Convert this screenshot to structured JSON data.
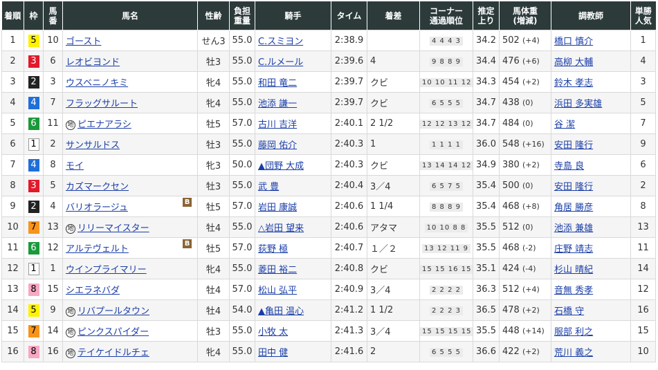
{
  "headers": {
    "rank": "着順",
    "waku": "枠",
    "umaban": [
      "馬",
      "番"
    ],
    "horse": "馬名",
    "age": "性齢",
    "weight": [
      "負担",
      "重量"
    ],
    "jockey": "騎手",
    "time": "タイム",
    "margin": "着差",
    "corner": [
      "コーナー",
      "通過順位"
    ],
    "last": [
      "推定",
      "上り"
    ],
    "bodyweight": [
      "馬体重",
      "(増減)"
    ],
    "trainer": "調教師",
    "pop": [
      "単勝",
      "人気"
    ]
  },
  "chi_mark": "地",
  "blinker_mark": "B",
  "colors": {
    "header_bg": "#2c3a3a",
    "link": "#1a3ea8",
    "waku": {
      "1": "#ffffff",
      "2": "#222222",
      "3": "#e21a2a",
      "4": "#1e6fd9",
      "5": "#fef200",
      "6": "#1a9a3a",
      "7": "#f7941d",
      "8": "#f6a8c4"
    }
  },
  "rows": [
    {
      "rank": "1",
      "waku": "5",
      "umaban": "10",
      "horse": "ゴースト",
      "chi": false,
      "blinker": false,
      "age": "せん3",
      "weight": "55.0",
      "jockey": "C.スミヨン",
      "time": "2:38.9",
      "margin": "",
      "corner": "4 4 4 3",
      "last": "34.2",
      "bw": "502",
      "bwd": "(+4)",
      "trainer": "橋口 慎介",
      "pop": "1"
    },
    {
      "rank": "2",
      "waku": "3",
      "umaban": "6",
      "horse": "レオビヨンド",
      "chi": false,
      "blinker": false,
      "age": "牡3",
      "weight": "55.0",
      "jockey": "C.ルメール",
      "time": "2:39.6",
      "margin": "4",
      "corner": "9 8 8 9",
      "last": "34.4",
      "bw": "476",
      "bwd": "(+6)",
      "trainer": "高柳 大輔",
      "pop": "4"
    },
    {
      "rank": "3",
      "waku": "2",
      "umaban": "3",
      "horse": "ウスベニノキミ",
      "chi": false,
      "blinker": false,
      "age": "牝4",
      "weight": "55.0",
      "jockey": "和田 竜二",
      "time": "2:39.7",
      "margin": "クビ",
      "corner": "10 10 11 12",
      "last": "34.3",
      "bw": "454",
      "bwd": "(+2)",
      "trainer": "鈴木 孝志",
      "pop": "3"
    },
    {
      "rank": "4",
      "waku": "4",
      "umaban": "7",
      "horse": "フラッグサルート",
      "chi": false,
      "blinker": false,
      "age": "牝4",
      "weight": "55.0",
      "jockey": "池添 謙一",
      "time": "2:39.7",
      "margin": "クビ",
      "corner": "6 5 5 5",
      "last": "34.7",
      "bw": "438",
      "bwd": "(0)",
      "trainer": "浜田 多実雄",
      "pop": "5"
    },
    {
      "rank": "5",
      "waku": "6",
      "umaban": "11",
      "horse": "ピエナアラシ",
      "chi": true,
      "blinker": false,
      "age": "牡5",
      "weight": "57.0",
      "jockey": "古川 吉洋",
      "time": "2:40.1",
      "margin": "2 1/2",
      "corner": "12 12 13 12",
      "last": "34.7",
      "bw": "484",
      "bwd": "(0)",
      "trainer": "谷 潔",
      "pop": "7"
    },
    {
      "rank": "6",
      "waku": "1",
      "umaban": "2",
      "horse": "サンサルドス",
      "chi": false,
      "blinker": false,
      "age": "牡3",
      "weight": "55.0",
      "jockey": "藤岡 佑介",
      "time": "2:40.3",
      "margin": "1",
      "corner": "1 1 1 1",
      "last": "36.0",
      "bw": "548",
      "bwd": "(+16)",
      "trainer": "安田 隆行",
      "pop": "9"
    },
    {
      "rank": "7",
      "waku": "4",
      "umaban": "8",
      "horse": "モイ",
      "chi": false,
      "blinker": false,
      "age": "牝3",
      "weight": "50.0",
      "jockey": "▲団野 大成",
      "time": "2:40.3",
      "margin": "クビ",
      "corner": "13 14 14 12",
      "last": "34.9",
      "bw": "380",
      "bwd": "(+2)",
      "trainer": "寺島 良",
      "pop": "6"
    },
    {
      "rank": "8",
      "waku": "3",
      "umaban": "5",
      "horse": "カズマークセン",
      "chi": false,
      "blinker": false,
      "age": "牡3",
      "weight": "55.0",
      "jockey": "武 豊",
      "time": "2:40.4",
      "margin": "3／4",
      "corner": "6 5 7 5",
      "last": "35.4",
      "bw": "500",
      "bwd": "(0)",
      "trainer": "安田 隆行",
      "pop": "2"
    },
    {
      "rank": "9",
      "waku": "2",
      "umaban": "4",
      "horse": "バリオラージュ",
      "chi": false,
      "blinker": true,
      "age": "牡5",
      "weight": "57.0",
      "jockey": "岩田 康誠",
      "time": "2:40.6",
      "margin": "1 1/4",
      "corner": "8 8 8 9",
      "last": "35.4",
      "bw": "468",
      "bwd": "(+8)",
      "trainer": "角居 勝彦",
      "pop": "8"
    },
    {
      "rank": "10",
      "waku": "7",
      "umaban": "13",
      "horse": "リリーマイスター",
      "chi": true,
      "blinker": false,
      "age": "牡4",
      "weight": "55.0",
      "jockey": "△岩田 望来",
      "time": "2:40.6",
      "margin": "アタマ",
      "corner": "10 10 8 8",
      "last": "35.5",
      "bw": "512",
      "bwd": "(0)",
      "trainer": "池添 兼雄",
      "pop": "13"
    },
    {
      "rank": "11",
      "waku": "6",
      "umaban": "12",
      "horse": "アルテヴェルト",
      "chi": false,
      "blinker": true,
      "age": "牡5",
      "weight": "57.0",
      "jockey": "荻野 極",
      "time": "2:40.7",
      "margin": "１／２",
      "corner": "13 12 11 9",
      "last": "35.5",
      "bw": "468",
      "bwd": "(-2)",
      "trainer": "庄野 靖志",
      "pop": "11"
    },
    {
      "rank": "12",
      "waku": "1",
      "umaban": "1",
      "horse": "ウインプライマリー",
      "chi": false,
      "blinker": false,
      "age": "牝4",
      "weight": "55.0",
      "jockey": "菱田 裕二",
      "time": "2:40.8",
      "margin": "クビ",
      "corner": "15 15 16 15",
      "last": "35.1",
      "bw": "424",
      "bwd": "(-4)",
      "trainer": "杉山 晴紀",
      "pop": "14"
    },
    {
      "rank": "13",
      "waku": "8",
      "umaban": "15",
      "horse": "シエラネバダ",
      "chi": false,
      "blinker": false,
      "age": "牡4",
      "weight": "57.0",
      "jockey": "松山 弘平",
      "time": "2:40.9",
      "margin": "3／4",
      "corner": "2 2 2 2",
      "last": "36.3",
      "bw": "512",
      "bwd": "(+4)",
      "trainer": "音無 秀孝",
      "pop": "12"
    },
    {
      "rank": "14",
      "waku": "5",
      "umaban": "9",
      "horse": "リバプールタウン",
      "chi": true,
      "blinker": false,
      "age": "牡4",
      "weight": "54.0",
      "jockey": "▲亀田 温心",
      "time": "2:41.2",
      "margin": "1 1/2",
      "corner": "2 2 2 3",
      "last": "36.5",
      "bw": "478",
      "bwd": "(+2)",
      "trainer": "石橋 守",
      "pop": "16"
    },
    {
      "rank": "15",
      "waku": "7",
      "umaban": "14",
      "horse": "ピンクスパイダー",
      "chi": true,
      "blinker": false,
      "age": "牡3",
      "weight": "55.0",
      "jockey": "小牧 太",
      "time": "2:41.3",
      "margin": "3／4",
      "corner": "15 15 15 15",
      "last": "35.5",
      "bw": "448",
      "bwd": "(+14)",
      "trainer": "服部 利之",
      "pop": "15"
    },
    {
      "rank": "16",
      "waku": "8",
      "umaban": "16",
      "horse": "テイケイドルチェ",
      "chi": true,
      "blinker": false,
      "age": "牝4",
      "weight": "55.0",
      "jockey": "田中 健",
      "time": "2:41.6",
      "margin": "2",
      "corner": "6 5 5 5",
      "last": "36.6",
      "bw": "422",
      "bwd": "(+2)",
      "trainer": "荒川 義之",
      "pop": "10"
    }
  ]
}
